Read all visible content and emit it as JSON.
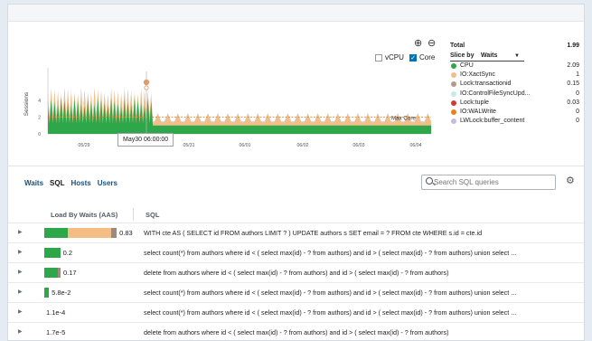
{
  "chart": {
    "ylabel": "Sessions",
    "y_ticks": [
      "4",
      "2",
      "0"
    ],
    "x_ticks": [
      "05/29",
      "May30 06:00:00",
      "05/31",
      "06/01",
      "06/02",
      "06/03",
      "06/04"
    ],
    "max_core_label": "Max Core",
    "vcpu_label": "vCPU",
    "core_label": "Core",
    "vcpu_checked": false,
    "core_checked": true,
    "tooltip_label": "May30 06:00:00",
    "zoom_in_icon": "zoom-in-icon",
    "zoom_out_icon": "zoom-out-icon",
    "colors": {
      "cpu": "#2ea64a",
      "xact": "#f3bd84",
      "lock_tx": "#b59a8c",
      "max_core": "#e8801e",
      "marker": "#e09b6d"
    }
  },
  "legend": {
    "total_label": "Total",
    "total_value": "1.99",
    "slice_by_label": "Slice by",
    "slice_by_value": "Waits",
    "items": [
      {
        "name": "CPU",
        "value": "2.09",
        "color": "#2ea64a"
      },
      {
        "name": "IO:XactSync",
        "value": "1",
        "color": "#f3bd84"
      },
      {
        "name": "Lock:transactionid",
        "value": "0.15",
        "color": "#b59a8c"
      },
      {
        "name": "IO:ControlFileSyncUpd...",
        "value": "0",
        "color": "#c9e7f0"
      },
      {
        "name": "Lock:tuple",
        "value": "0.03",
        "color": "#d13a2e"
      },
      {
        "name": "IO:WALWrite",
        "value": "0",
        "color": "#e8801e"
      },
      {
        "name": "LWLock:buffer_content",
        "value": "0",
        "color": "#c9b8df"
      }
    ]
  },
  "tabs": [
    "Waits",
    "SQL",
    "Hosts",
    "Users"
  ],
  "active_tab": "SQL",
  "search": {
    "placeholder": "Search SQL queries"
  },
  "settings_icon": "gear-icon",
  "table": {
    "headers": [
      "Load By Waits (AAS)",
      "SQL"
    ],
    "rows": [
      {
        "load": "0.83",
        "segments": [
          {
            "frac": 0.3,
            "color": "#2ea64a"
          },
          {
            "frac": 0.54,
            "color": "#f3bd84"
          },
          {
            "frac": 0.07,
            "color": "#9b8a80"
          }
        ],
        "sql": "WITH cte AS ( SELECT id FROM authors LIMIT ? ) UPDATE authors s SET email = ? FROM cte WHERE s.id = cte.id"
      },
      {
        "load": "0.2",
        "segments": [
          {
            "frac": 0.2,
            "color": "#2ea64a"
          }
        ],
        "sql": "select count(*) from authors where id < ( select max(id) - ? from authors) and id > ( select max(id) - ? from authors) union select ..."
      },
      {
        "load": "0.17",
        "segments": [
          {
            "frac": 0.17,
            "color": "#2ea64a"
          },
          {
            "frac": 0.02,
            "color": "#9b8a80"
          }
        ],
        "sql": "delete from authors where id < ( select max(id) - ? from authors) and id > ( select max(id) - ? from authors)"
      },
      {
        "load": "5.8e-2",
        "segments": [
          {
            "frac": 0.058,
            "color": "#2ea64a"
          }
        ],
        "sql": "select count(*) from authors where id < ( select max(id) - ? from authors) and id > ( select max(id) - ? from authors) union select ..."
      },
      {
        "load": "1.1e-4",
        "segments": [],
        "sql": "select count(*) from authors where id < ( select max(id) - ? from authors) and id > ( select max(id) - ? from authors) union select ..."
      },
      {
        "load": "1.7e-5",
        "segments": [],
        "sql": "delete from authors where id < ( select max(id) - ? from authors) and id > ( select max(id) - ? from authors)"
      }
    ]
  }
}
